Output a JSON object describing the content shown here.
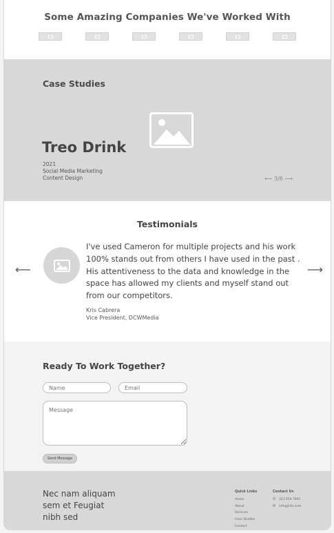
{
  "companies": {
    "heading": "Some Amazing Companies We've Worked With",
    "logos": [
      "image-icon",
      "image-icon",
      "image-icon",
      "image-icon",
      "image-icon",
      "image-icon"
    ]
  },
  "case_studies": {
    "heading": "Case Studies",
    "title": "Treo Drink",
    "year": "2021",
    "services": [
      "Social Media Marketing",
      "Content Design"
    ],
    "pager": "3/6",
    "prev_icon": "arrow-left-icon",
    "next_icon": "arrow-right-icon"
  },
  "testimonials": {
    "heading": "Testimonials",
    "quote": "I've used Cameron for multiple projects and his work 100% stands out from others I have used in the past . His attentiveness to the data and knowledge in the space has allowed my clients and myself stand out from our competitors.",
    "author_name": "Kris Cabrera",
    "author_title": "Vice President, DCWMedia",
    "prev_arrow": "⟵",
    "next_arrow": "⟶"
  },
  "contact": {
    "heading": "Ready To Work Together?",
    "name_placeholder": "Name",
    "email_placeholder": "Email",
    "message_placeholder": "Message",
    "send_label": "Send Message"
  },
  "footer": {
    "tagline": [
      "Nec nam aliquam",
      "sem et Feugiat",
      "nibh sed"
    ],
    "quick_links": {
      "heading": "Quick Links",
      "items": [
        "Home",
        "About",
        "Services",
        "Case Studies",
        "Contact"
      ]
    },
    "contact_us": {
      "heading": "Contact Us",
      "phone": "321 654 7891",
      "email": "info@info.com",
      "phone_icon": "phone-icon",
      "email_icon": "mail-icon"
    }
  }
}
